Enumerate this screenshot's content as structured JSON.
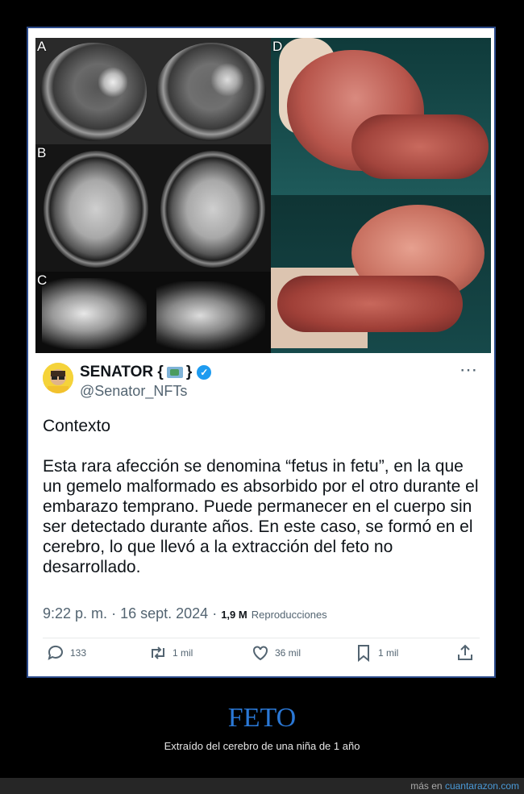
{
  "image": {
    "labels": {
      "a": "A",
      "b": "B",
      "c": "C",
      "d": "D"
    }
  },
  "tweet": {
    "display_name": "SENATOR {",
    "display_name_end": "}",
    "handle": "@Senator_NFTs",
    "more_icon": "⋯",
    "paragraphs": [
      "Contexto",
      "Esta rara afección se denomina “fetus in fetu”, en la que un gemelo malformado es absorbido por el otro durante el embarazo temprano. Puede permanecer en el cuerpo sin ser detectado durante años. En este caso, se formó en el cerebro, lo que llevó a la extracción del feto no desarrollado."
    ],
    "time": "9:22 p. m.",
    "separator": "·",
    "date": "16 sept. 2024",
    "views_count": "1,9 M",
    "views_label": "Reproducciones",
    "actions": {
      "replies": "133",
      "retweets": "1 mil",
      "likes": "36 mil",
      "bookmarks": "1 mil"
    },
    "icons": [
      "reply-icon",
      "retweet-icon",
      "like-icon",
      "bookmark-icon",
      "share-icon",
      "verified-icon"
    ],
    "accent_color": "#1d9bf0"
  },
  "caption": {
    "title": "FETO",
    "subtitle": "Extraído del cerebro de una niña de 1 año",
    "title_color": "#2a78d6"
  },
  "footer": {
    "prefix": "más en",
    "site": "cuantarazon.com"
  }
}
